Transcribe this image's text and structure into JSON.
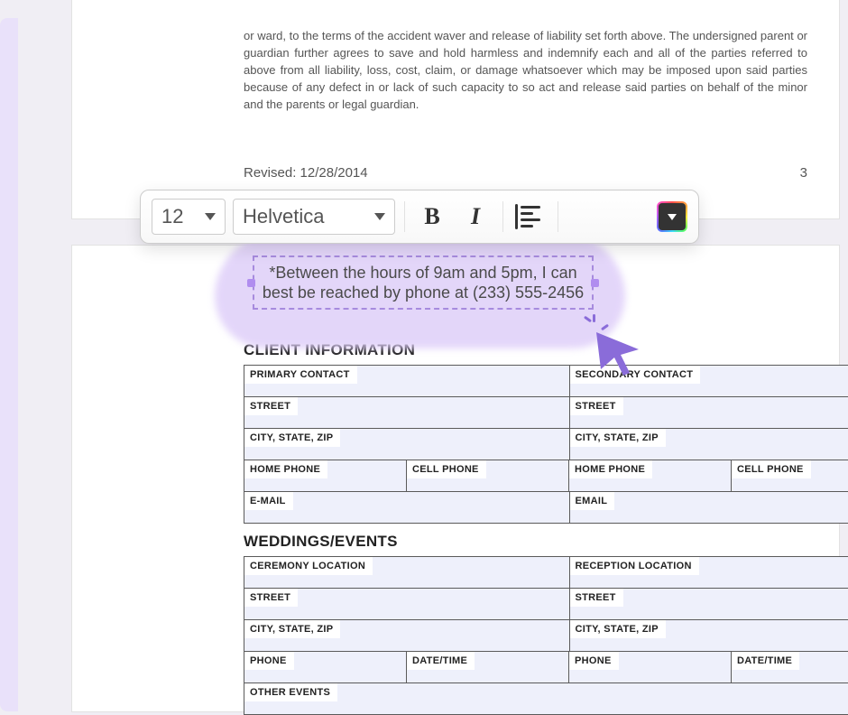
{
  "doc": {
    "legal": "or ward, to the terms of the accident waver and release of liability set forth above. The undersigned parent or guardian further agrees to save and hold harmless and indemnify each and all of the parties referred to above from all liability, loss, cost, claim, or damage whatsoever which may be imposed upon said parties because of any defect in or lack of such capacity to so act and release said parties on behalf of the minor and the parents or legal guardian.",
    "revised": "Revised: 12/28/2014",
    "page": "3"
  },
  "toolbar": {
    "size": "12",
    "font": "Helvetica"
  },
  "textbox": {
    "content": "*Between the hours of 9am and 5pm, I can best be reached by phone at (233) 555-2456"
  },
  "form": {
    "client": {
      "title": "CLIENT INFORMATION",
      "labels": {
        "primary": "PRIMARY CONTACT",
        "secondary": "SECONDARY CONTACT",
        "street1": "STREET",
        "street2": "STREET",
        "csz1": "CITY, STATE, ZIP",
        "csz2": "CITY, STATE, ZIP",
        "home1": "HOME PHONE",
        "cell1": "CELL PHONE",
        "home2": "HOME PHONE",
        "cell2": "CELL PHONE",
        "email1": "E-MAIL",
        "email2": "EMAIL"
      }
    },
    "events": {
      "title": "WEDDINGS/EVENTS",
      "labels": {
        "ceremony": "CEREMONY LOCATION",
        "reception": "RECEPTION LOCATION",
        "street1": "STREET",
        "street2": "STREET",
        "csz1": "CITY, STATE, ZIP",
        "csz2": "CITY, STATE, ZIP",
        "phone1": "PHONE",
        "dt1": "DATE/TIME",
        "phone2": "PHONE",
        "dt2": "DATE/TIME",
        "other": "OTHER EVENTS"
      }
    }
  }
}
